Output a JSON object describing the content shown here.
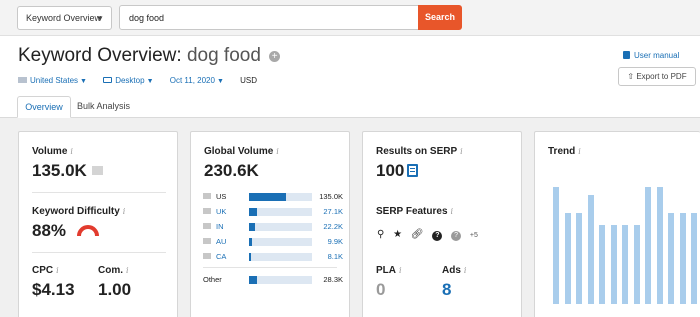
{
  "search_bar": {
    "database_label": "Keyword Overview",
    "query": "dog food",
    "search_button": "Search"
  },
  "header": {
    "title_prefix": "Keyword Overview:",
    "keyword": "dog food",
    "country": "United States",
    "device": "Desktop",
    "date": "Oct 11, 2020",
    "currency": "USD",
    "user_manual": "User manual",
    "export": "Export to PDF"
  },
  "tabs": [
    "Overview",
    "Bulk Analysis"
  ],
  "info_glyph": "i",
  "metrics": {
    "volume": {
      "label": "Volume",
      "value": "135.0K"
    },
    "keyword_difficulty": {
      "label": "Keyword Difficulty",
      "value": "88%",
      "level": 0.88
    },
    "cpc": {
      "label": "CPC",
      "value": "$4.13"
    },
    "competition": {
      "label": "Com.",
      "value": "1.00"
    }
  },
  "global_volume": {
    "label": "Global Volume",
    "value": "230.6K",
    "countries": [
      {
        "code": "US",
        "value": "135.0K",
        "share": 0.59,
        "link": false
      },
      {
        "code": "UK",
        "value": "27.1K",
        "share": 0.12,
        "link": true
      },
      {
        "code": "IN",
        "value": "22.2K",
        "share": 0.1,
        "link": true
      },
      {
        "code": "AU",
        "value": "9.9K",
        "share": 0.04,
        "link": true
      },
      {
        "code": "CA",
        "value": "8.1K",
        "share": 0.035,
        "link": true
      }
    ],
    "other": {
      "code": "Other",
      "value": "28.3K",
      "share": 0.12
    }
  },
  "serp": {
    "results_label": "Results on SERP",
    "results_value": "100",
    "features_label": "SERP Features",
    "features_icons": [
      "location-pin-icon",
      "star-icon",
      "link-icon",
      "question-icon",
      "question-icon-gray"
    ],
    "more_features": "+5",
    "pla_label": "PLA",
    "pla_value": "0",
    "ads_label": "Ads",
    "ads_value": "8",
    "ads_color": "#1a6fb5"
  },
  "trend": {
    "label": "Trend",
    "values": [
      0.86,
      0.67,
      0.67,
      0.8,
      0.58,
      0.58,
      0.58,
      0.58,
      0.86,
      0.86,
      0.67,
      0.67,
      0.67
    ]
  },
  "colors": {
    "accent": "#1a6fb5",
    "search_button": "#e8562a",
    "kd_gauge": "#e23b2e",
    "trend_bar": "#a9cdec"
  }
}
